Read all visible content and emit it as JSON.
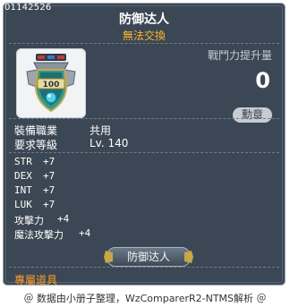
{
  "item": {
    "code": "01142526",
    "name": "防御达人",
    "trade_status": "無法交換",
    "cp_label": "戰鬥力提升量",
    "cp_value": "0",
    "badge": "勳章"
  },
  "requirements": [
    {
      "label": "裝備職業",
      "value": "共用"
    },
    {
      "label": "要求等級",
      "value": "Lv. 140"
    }
  ],
  "stats": [
    {
      "label": "STR",
      "value": "+7"
    },
    {
      "label": "DEX",
      "value": "+7"
    },
    {
      "label": "INT",
      "value": "+7"
    },
    {
      "label": "LUK",
      "value": "+7"
    },
    {
      "label": "攻擊力",
      "value": "+4"
    },
    {
      "label": "魔法攻擊力",
      "value": "+4"
    }
  ],
  "set_name": "防御达人",
  "exclusive_label": "專屬道具",
  "footer": "＠ 数据由小册子整理，WzComparerR2-NTMS解析 ＠",
  "colors": {
    "panel_bg": "#3b4754",
    "orange": "#ffb62c",
    "white": "#ffffff",
    "badge_bg": "#c6ccd1"
  },
  "icon": {
    "name": "defense-medal-icon",
    "number": "100"
  }
}
